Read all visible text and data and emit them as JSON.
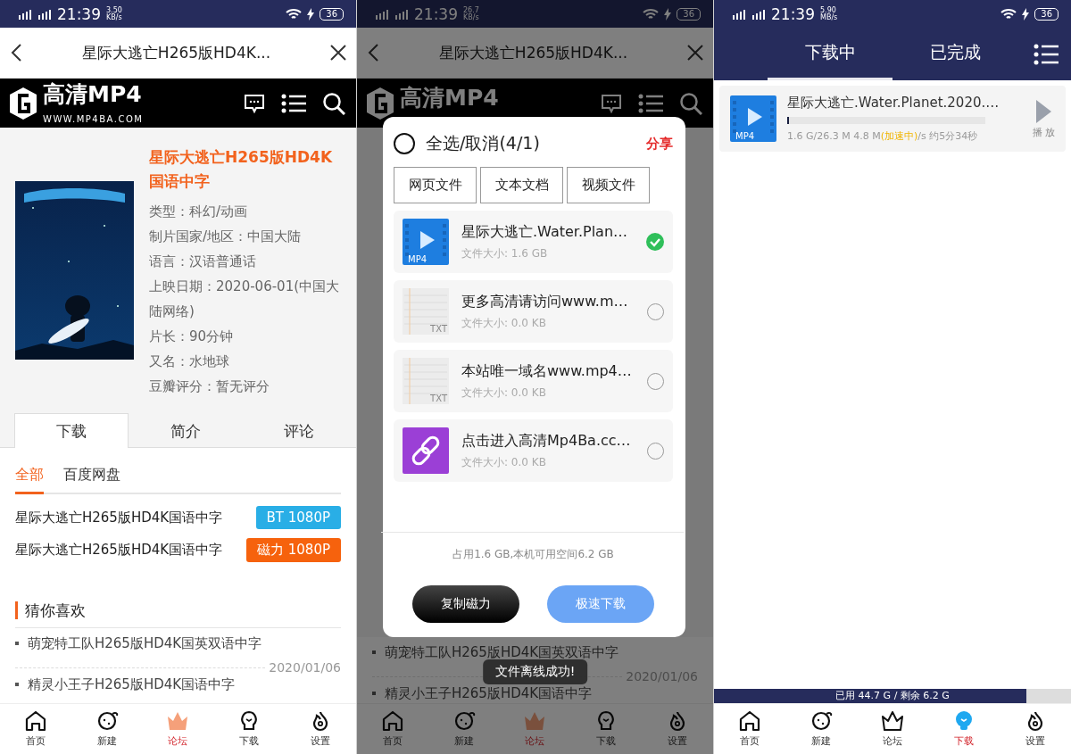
{
  "screens": [
    {
      "kind": "detail",
      "status_bar": {
        "time": "21:39",
        "speed": "3.50",
        "speed_unit": "KB/s",
        "battery": "36"
      },
      "header": {
        "title": "星际大逃亡H265版HD4K..."
      },
      "logo": {
        "name": "高清MP4",
        "url": "WWW.MP4BA.COM"
      },
      "movie": {
        "title": "星际大逃亡H265版HD4K国语中字",
        "info": [
          "类型：科幻/动画",
          "制片国家/地区：中国大陆",
          "语言：汉语普通话",
          "上映日期：2020-06-01(中国大陆网络)",
          "片长：90分钟",
          "又名：水地球",
          "豆瓣评分：暂无评分"
        ]
      },
      "tabs": [
        {
          "label": "下载",
          "selected": true
        },
        {
          "label": "简介",
          "selected": false
        },
        {
          "label": "评论",
          "selected": false
        }
      ],
      "subtabs": [
        {
          "label": "全部",
          "selected": true
        },
        {
          "label": "百度网盘",
          "selected": false
        }
      ],
      "downloads": [
        {
          "name": "星际大逃亡H265版HD4K国语中字",
          "button": "BT 1080P",
          "color": "#29aee6"
        },
        {
          "name": "星际大逃亡H265版HD4K国语中字",
          "button": "磁力 1080P",
          "color": "#f6620d"
        }
      ],
      "section_title": "猜你喜欢",
      "recommendations": [
        {
          "title": "萌宠特工队H265版HD4K国英双语中字",
          "date": "2020/01/06"
        },
        {
          "title": "精灵小王子H265版HD4K国语中字"
        }
      ],
      "nav": [
        {
          "label": "首页",
          "kind": "home",
          "selected": false
        },
        {
          "label": "新建",
          "kind": "planet",
          "selected": false
        },
        {
          "label": "论坛",
          "kind": "crown",
          "selected": true
        },
        {
          "label": "下载",
          "kind": "bulb",
          "selected": false
        },
        {
          "label": "设置",
          "kind": "flame",
          "selected": false
        }
      ]
    },
    {
      "kind": "dialog",
      "status_bar": {
        "time": "21:39",
        "speed": "26.7",
        "speed_unit": "KB/s",
        "battery": "36"
      },
      "header": {
        "title": "星际大逃亡H265版HD4K..."
      },
      "logo": {
        "name": "高清MP4"
      },
      "recommendations": [
        {
          "title": "萌宠特工队H265版HD4K国英双语中字",
          "date": "2020/01/06"
        },
        {
          "title": "精灵小王子H265版HD4K国语中字"
        }
      ],
      "nav": [
        {
          "label": "首页",
          "kind": "home",
          "selected": false
        },
        {
          "label": "新建",
          "kind": "planet",
          "selected": false
        },
        {
          "label": "论坛",
          "kind": "crown",
          "selected": true
        },
        {
          "label": "下载",
          "kind": "bulb",
          "selected": false
        },
        {
          "label": "设置",
          "kind": "flame",
          "selected": false
        }
      ],
      "dialog": {
        "select_all": {
          "label": "全选/取消(4/1)",
          "checked": false
        },
        "share": "分享",
        "filters": [
          "网页文件",
          "文本文档",
          "视频文件"
        ],
        "files": [
          {
            "kind": "video",
            "badge": "MP4",
            "name": "星际大逃亡.Water.Plan…",
            "size": "文件大小: 1.6 GB",
            "selected": true
          },
          {
            "kind": "text",
            "badge": "TXT",
            "name": "更多高清请访问www.m…",
            "size": "文件大小: 0.0 KB",
            "selected": false
          },
          {
            "kind": "text",
            "badge": "TXT",
            "name": "本站唯一域名www.mp4…",
            "size": "文件大小: 0.0 KB",
            "selected": false
          },
          {
            "kind": "link",
            "name": "点击进入高清Mp4Ba.cc…",
            "size": "文件大小: 0.0 KB",
            "selected": false
          }
        ],
        "storage": "占用1.6 GB,本机可用空间6.2 GB",
        "buttons": [
          "复制磁力",
          "极速下载"
        ]
      },
      "toast": "文件离线成功!"
    },
    {
      "kind": "downloads",
      "status_bar": {
        "time": "21:39",
        "speed": "5.90",
        "speed_unit": "MB/s",
        "battery": "36"
      },
      "tabs": [
        {
          "label": "下载中",
          "selected": true
        },
        {
          "label": "已完成",
          "selected": false
        }
      ],
      "tasks": [
        {
          "badge": "MP4",
          "name": "星际大逃亡.Water.Planet.2020.…",
          "level": 0.01,
          "stats": "1.6 G/26.3 M 4.8 M",
          "boost": "(加速中)",
          "rate": "/s 约5分34秒",
          "play": "播 放"
        }
      ],
      "storage": {
        "text": "已用 44.7 G / 剩余 6.2 G",
        "level": 0.875
      },
      "nav": [
        {
          "label": "首页",
          "kind": "home",
          "selected": false
        },
        {
          "label": "新建",
          "kind": "planet",
          "selected": false
        },
        {
          "label": "论坛",
          "kind": "crown",
          "selected": false
        },
        {
          "label": "下载",
          "kind": "bulb",
          "selected": true
        },
        {
          "label": "设置",
          "kind": "flame",
          "selected": false
        }
      ]
    }
  ]
}
